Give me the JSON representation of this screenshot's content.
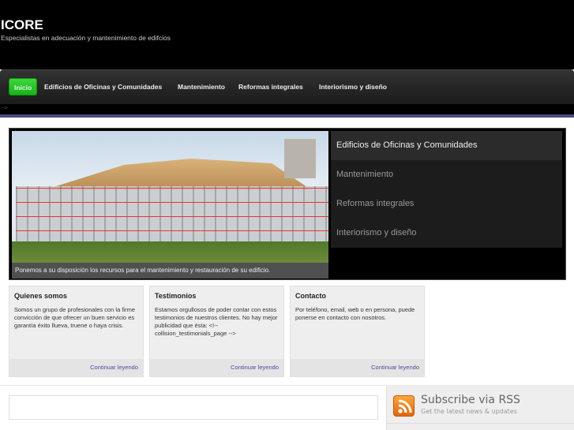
{
  "header": {
    "title": "ICORE",
    "tagline": "Especialistas en adecuación y mantenimiento de edifcios"
  },
  "nav": {
    "items": [
      "Inicio",
      "Edificios de Oficinas y Comunidades",
      "Mantenimiento",
      "Reformas integrales",
      "Interiorismo y diseño"
    ]
  },
  "stray_text": "-->",
  "slider": {
    "caption": "Ponemos a su disposición los recursos para el mantenimiento y restauración de su edificio.",
    "items": [
      "Edificios de Oficinas y Comunidades",
      "Mantenimiento",
      "Reformas integrales",
      "Interiorismo y diseño"
    ]
  },
  "cards": [
    {
      "title": "Quienes somos",
      "text": "Somos un grupo de profesionales con la firme convicción de que ofrecer un buen servicio es garantía éxito llueva, truene o haya crisis.",
      "link": "Continuar leyendo"
    },
    {
      "title": "Testimonios",
      "text": "Estamos orgullosos de poder contar con estos testimonios de nuestros clientes. No hay mejor publicidad que ésta: <!-- collision_testimonials_page -->",
      "link": "Continuar leyendo"
    },
    {
      "title": "Contacto",
      "text": "Por teléfono, email, web o en persona, puede ponerse en contacto con nosotros.",
      "link": "Continuar leyendo"
    }
  ],
  "sidebar": {
    "rss_title": "Subscribe via RSS",
    "rss_subtitle": "Get the latest news & updates"
  },
  "colors": {
    "nav_active": "#22c322",
    "purple_bar": "#4a4a80",
    "link": "#4a4a9a",
    "rss": "#f28a1f"
  }
}
